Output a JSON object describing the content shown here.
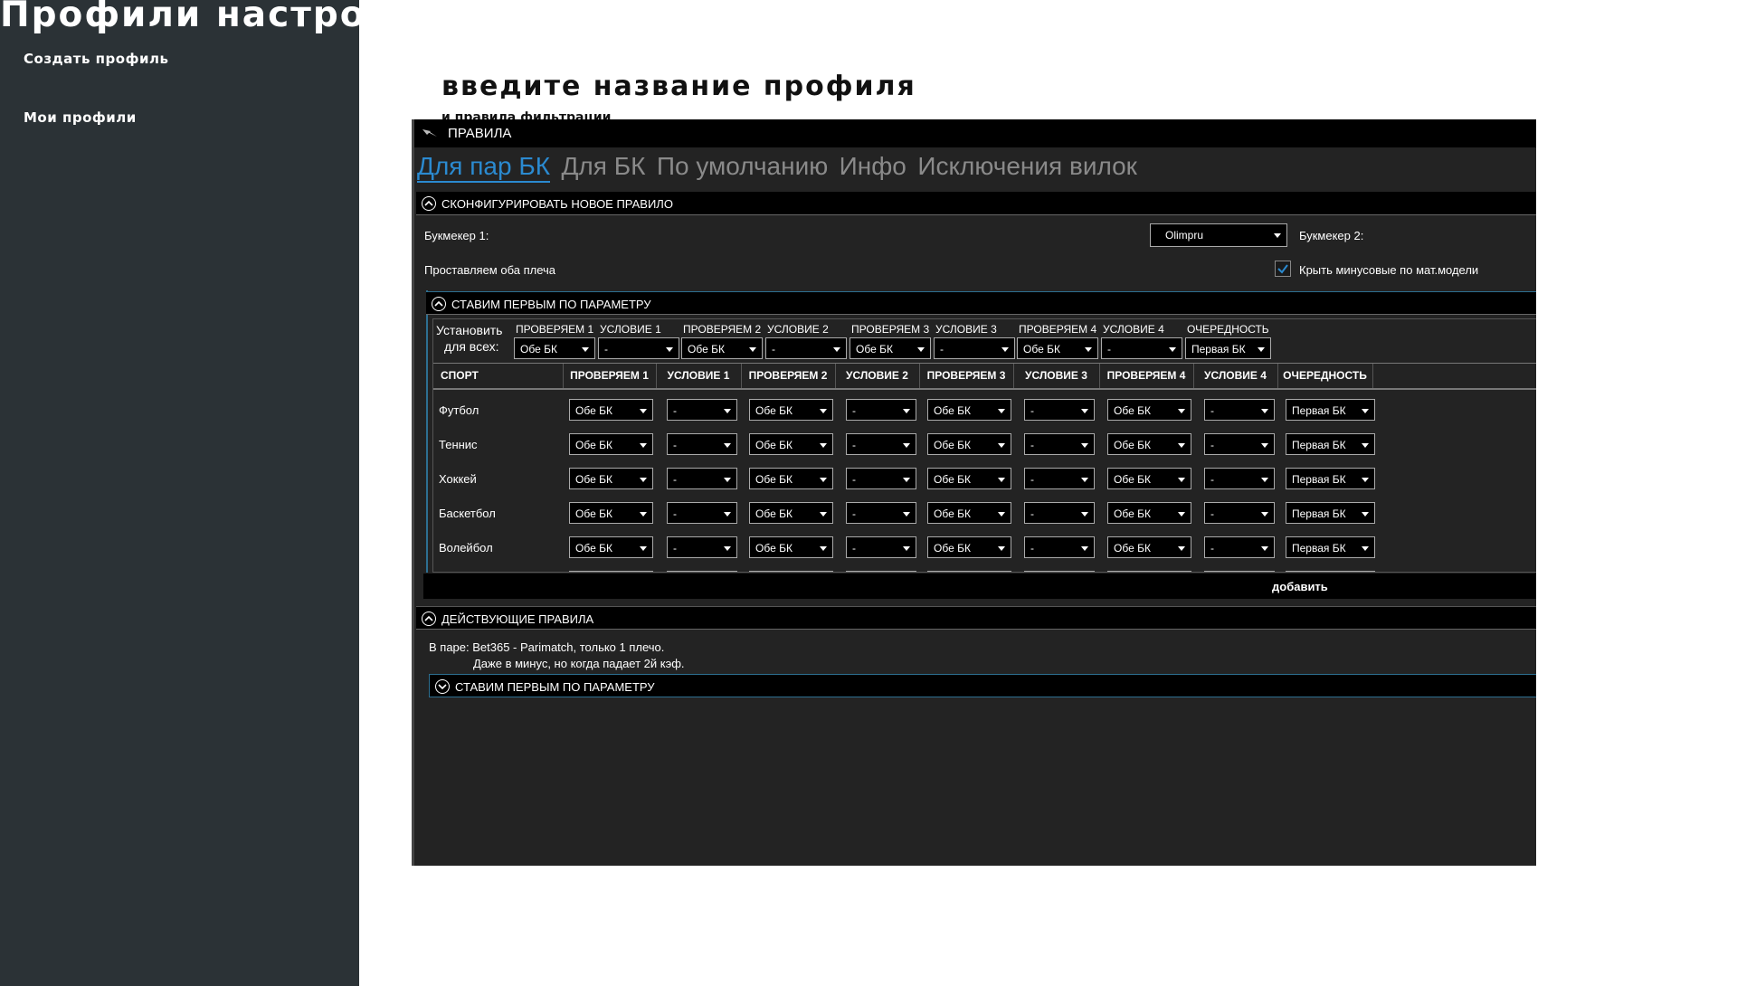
{
  "sidebar": {
    "title": "Профили настроек",
    "create_profile": "Создать профиль",
    "my_profiles": "Мои профили"
  },
  "main": {
    "heading": "введите название профиля",
    "sub": "и правила фильтрации"
  },
  "window": {
    "title": "ПРАВИЛА",
    "tabs": [
      "Для пар БК",
      "Для БК",
      "По умолчанию",
      "Инфо",
      "Исключения вилок"
    ],
    "active_tab": "Для пар БК"
  },
  "new_rule": {
    "header": "СКОНФИГУРИРОВАТЬ НОВОЕ ПРАВИЛО",
    "bookmaker1_label": "Букмекер 1:",
    "bookmaker1_value": "Olimpru",
    "bookmaker2_label": "Букмекер 2:",
    "both_legs_label": "Проставляем оба плеча",
    "cover_minus_label": "Крыть минусовые по мат.модели",
    "cover_minus_checked": true,
    "first_by_param_header": "СТАВИМ ПЕРВЫМ ПО ПАРАМЕТРУ",
    "set_all_label_line1": "Установить",
    "set_all_label_line2": "для всех:",
    "set_all_headers": [
      "ПРОВЕРЯЕМ 1",
      "УСЛОВИЕ 1",
      "ПРОВЕРЯЕМ 2",
      "УСЛОВИЕ 2",
      "ПРОВЕРЯЕМ 3",
      "УСЛОВИЕ 3",
      "ПРОВЕРЯЕМ 4",
      "УСЛОВИЕ 4",
      "ОЧЕРЕДНОСТЬ"
    ],
    "set_all_values": [
      "Обе БК",
      "-",
      "Обе БК",
      "-",
      "Обе БК",
      "-",
      "Обе БК",
      "-",
      "Первая БК"
    ],
    "grid_headers": [
      "СПОРТ",
      "ПРОВЕРЯЕМ 1",
      "УСЛОВИЕ 1",
      "ПРОВЕРЯЕМ 2",
      "УСЛОВИЕ 2",
      "ПРОВЕРЯЕМ 3",
      "УСЛОВИЕ 3",
      "ПРОВЕРЯЕМ 4",
      "УСЛОВИЕ 4",
      "ОЧЕРЕДНОСТЬ"
    ],
    "rows": [
      {
        "sport": "Футбол",
        "values": [
          "Обе БК",
          "-",
          "Обе БК",
          "-",
          "Обе БК",
          "-",
          "Обе БК",
          "-",
          "Первая БК"
        ]
      },
      {
        "sport": "Теннис",
        "values": [
          "Обе БК",
          "-",
          "Обе БК",
          "-",
          "Обе БК",
          "-",
          "Обе БК",
          "-",
          "Первая БК"
        ]
      },
      {
        "sport": "Хоккей",
        "values": [
          "Обе БК",
          "-",
          "Обе БК",
          "-",
          "Обе БК",
          "-",
          "Обе БК",
          "-",
          "Первая БК"
        ]
      },
      {
        "sport": "Баскетбол",
        "values": [
          "Обе БК",
          "-",
          "Обе БК",
          "-",
          "Обе БК",
          "-",
          "Обе БК",
          "-",
          "Первая БК"
        ]
      },
      {
        "sport": "Волейбол",
        "values": [
          "Обе БК",
          "-",
          "Обе БК",
          "-",
          "Обе БК",
          "-",
          "Обе БК",
          "-",
          "Первая БК"
        ]
      }
    ],
    "add_button": "добавить"
  },
  "active_rules": {
    "header": "ДЕЙСТВУЮЩИЕ ПРАВИЛА",
    "line1": "В паре: Bet365 - Parimatch, только 1 плечо.",
    "line2": "Даже в минус, но когда падает 2й кэф.",
    "sub_header": "СТАВИМ ПЕРВЫМ ПО ПАРАМЕТРУ"
  },
  "colors": {
    "sidebar_bg": "#2b3236",
    "window_bg": "#232323",
    "accent": "#2b8ad0"
  }
}
